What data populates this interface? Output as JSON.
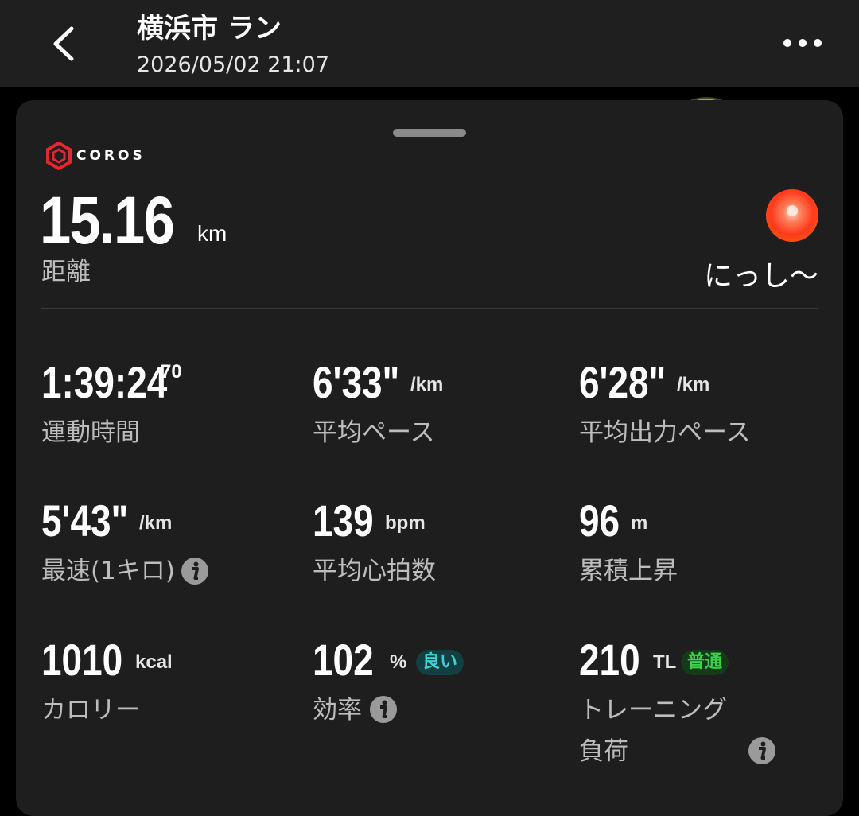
{
  "header": {
    "title": "横浜市 ラン",
    "datetime": "2026/05/02 21:07"
  },
  "brand": {
    "logo_text": "COROS",
    "accent": "#e8262d"
  },
  "summary": {
    "distance_value": "15.16",
    "distance_unit": "km",
    "distance_label": "距離",
    "username": "にっし〜"
  },
  "stats": {
    "time": {
      "value": "1:39:24",
      "fraction": "70",
      "label": "運動時間"
    },
    "avg_pace": {
      "value": "6'33\"",
      "unit": "/km",
      "label": "平均ペース"
    },
    "avg_power_pace": {
      "value": "6'28\"",
      "unit": "/km",
      "label": "平均出力ペース"
    },
    "best_km": {
      "value": "5'43\"",
      "unit": "/km",
      "label": "最速(1キロ)"
    },
    "avg_hr": {
      "value": "139",
      "unit": "bpm",
      "label": "平均心拍数"
    },
    "elevation": {
      "value": "96",
      "unit": "m",
      "label": "累積上昇"
    },
    "calories": {
      "value": "1010",
      "unit": "kcal",
      "label": "カロリー"
    },
    "efficiency": {
      "value": "102",
      "unit": "%",
      "label": "効率",
      "badge": "良い",
      "badge_color": "#3fd0d6",
      "badge_bg": "#123f42"
    },
    "training_load": {
      "value": "210",
      "unit": "TL",
      "label_line1": "トレーニング",
      "label_line2": "負荷",
      "badge": "普通",
      "badge_color": "#39d24a",
      "badge_bg": "#143a18"
    }
  },
  "icons": {
    "back": "chevron-left-icon",
    "more": "more-horizontal-icon",
    "info": "info-icon"
  }
}
